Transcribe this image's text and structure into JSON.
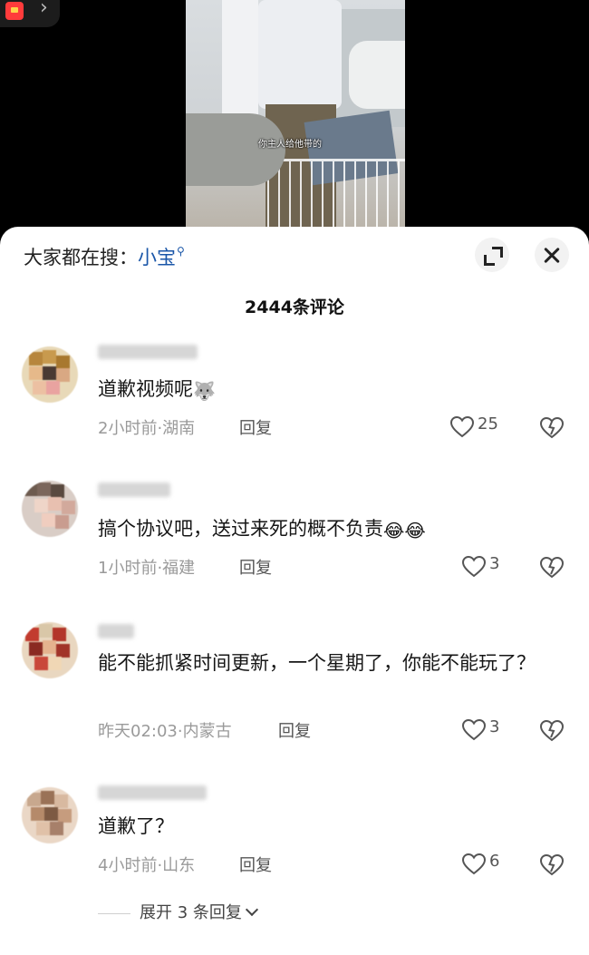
{
  "video": {
    "caption": "你主人给他带的"
  },
  "header": {
    "search_prefix": "大家都在搜：",
    "search_term": "小宝",
    "search_icon": "search-icon",
    "comment_count": "2444条评论"
  },
  "comments": [
    {
      "username": "",
      "text": "道歉视频呢",
      "emoji": "husky-emoji",
      "time_location": "2小时前·湖南",
      "reply_label": "回复",
      "likes": "25"
    },
    {
      "username": "",
      "text": "搞个协议吧，送过来死的概不负责",
      "emoji": "laughing-crying-emoji",
      "time_location": "1小时前·福建",
      "reply_label": "回复",
      "likes": "3"
    },
    {
      "username": "",
      "text": "能不能抓紧时间更新，一个星期了，你能不能玩了？",
      "time_location": "昨天02:03·内蒙古",
      "reply_label": "回复",
      "likes": "3"
    },
    {
      "username": "",
      "text": "道歉了？",
      "time_location": "4小时前·山东",
      "reply_label": "回复",
      "likes": "6",
      "expand_replies": "展开 3 条回复"
    }
  ],
  "colors": {
    "sheet_bg": "#ffffff",
    "search_term": "#1a56a8",
    "meta_text": "#9a9a9a"
  }
}
